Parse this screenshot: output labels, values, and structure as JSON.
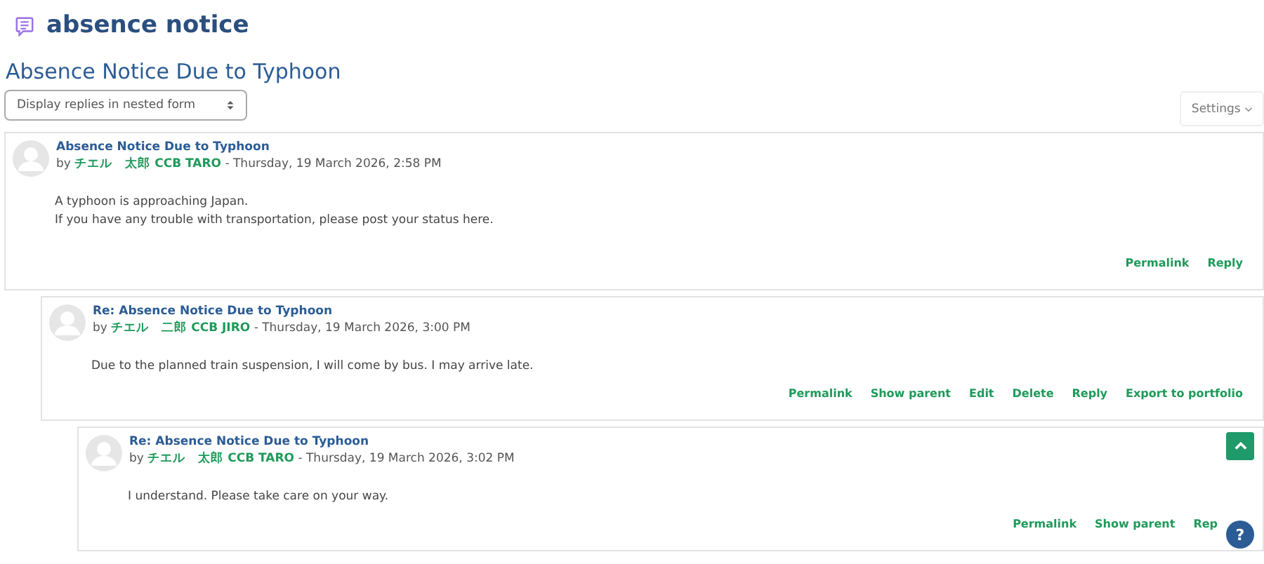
{
  "page_title": "absence notice",
  "discussion_title": "Absence Notice Due to Typhoon",
  "display_mode": {
    "value": "Display replies in nested form"
  },
  "settings_button": "Settings",
  "posts": [
    {
      "subject": "Absence Notice Due to Typhoon",
      "by": "by",
      "author": "チエル　太郎 CCB TARO",
      "date": "- Thursday, 19 March 2026, 2:58 PM",
      "body": [
        "A typhoon is approaching Japan.",
        "If you have any trouble with transportation, please post your status here."
      ],
      "actions": [
        "Permalink",
        "Reply"
      ],
      "children": [
        {
          "subject": "Re: Absence Notice Due to Typhoon",
          "by": "by",
          "author": "チエル　二郎 CCB JIRO",
          "date": "- Thursday, 19 March 2026, 3:00 PM",
          "body": [
            "Due to the planned train suspension, I will come by bus. I may arrive late."
          ],
          "actions": [
            "Permalink",
            "Show parent",
            "Edit",
            "Delete",
            "Reply",
            "Export to portfolio"
          ],
          "children": [
            {
              "subject": "Re: Absence Notice Due to Typhoon",
              "by": "by",
              "author": "チエル　太郎 CCB TARO",
              "date": "- Thursday, 19 March 2026, 3:02 PM",
              "body": [
                "I understand. Please take care on your way."
              ],
              "actions": [
                "Permalink",
                "Show parent",
                "Rep"
              ]
            }
          ]
        }
      ]
    }
  ],
  "help_button": "?"
}
